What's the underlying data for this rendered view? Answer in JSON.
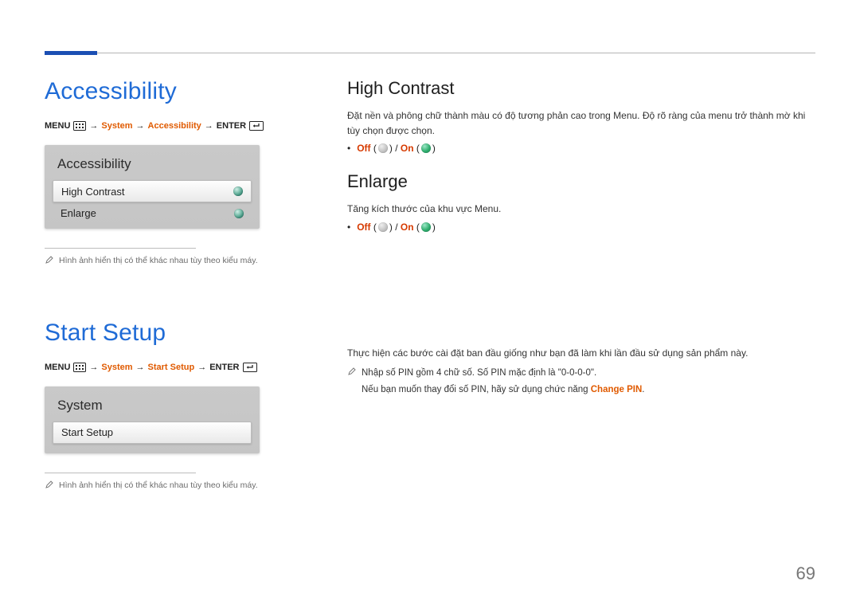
{
  "page_number": "69",
  "sections": {
    "accessibility": {
      "title": "Accessibility",
      "menupath": {
        "menu": "MENU",
        "system": "System",
        "accessibility": "Accessibility",
        "enter": "ENTER"
      },
      "panel": {
        "title": "Accessibility",
        "items": [
          "High Contrast",
          "Enlarge"
        ]
      },
      "footnote": "Hình ảnh hiển thị có thể khác nhau tùy theo kiểu máy."
    },
    "start_setup": {
      "title": "Start Setup",
      "menupath": {
        "menu": "MENU",
        "system": "System",
        "start_setup": "Start Setup",
        "enter": "ENTER"
      },
      "panel": {
        "title": "System",
        "items": [
          "Start Setup"
        ]
      },
      "footnote": "Hình ảnh hiển thị có thể khác nhau tùy theo kiểu máy."
    }
  },
  "right": {
    "high_contrast": {
      "title": "High Contrast",
      "desc": "Đặt nền và phông chữ thành màu có độ tương phản cao trong Menu. Độ rõ ràng của menu trở thành mờ khi tùy chọn được chọn.",
      "opts": {
        "off": "Off",
        "on": "On",
        "sep": " / "
      }
    },
    "enlarge": {
      "title": "Enlarge",
      "desc": "Tăng kích thước của khu vực Menu.",
      "opts": {
        "off": "Off",
        "on": "On",
        "sep": " / "
      }
    },
    "start_setup": {
      "desc": "Thực hiện các bước cài đặt ban đầu giống như bạn đã làm khi lần đầu sử dụng sản phẩm này.",
      "notes": [
        "Nhập số PIN gồm 4 chữ số. Số PIN mặc định là \"0-0-0-0\".",
        "Nếu bạn muốn thay đổi số PIN, hãy sử dụng chức năng "
      ],
      "change_pin": "Change PIN",
      "period": "."
    }
  }
}
